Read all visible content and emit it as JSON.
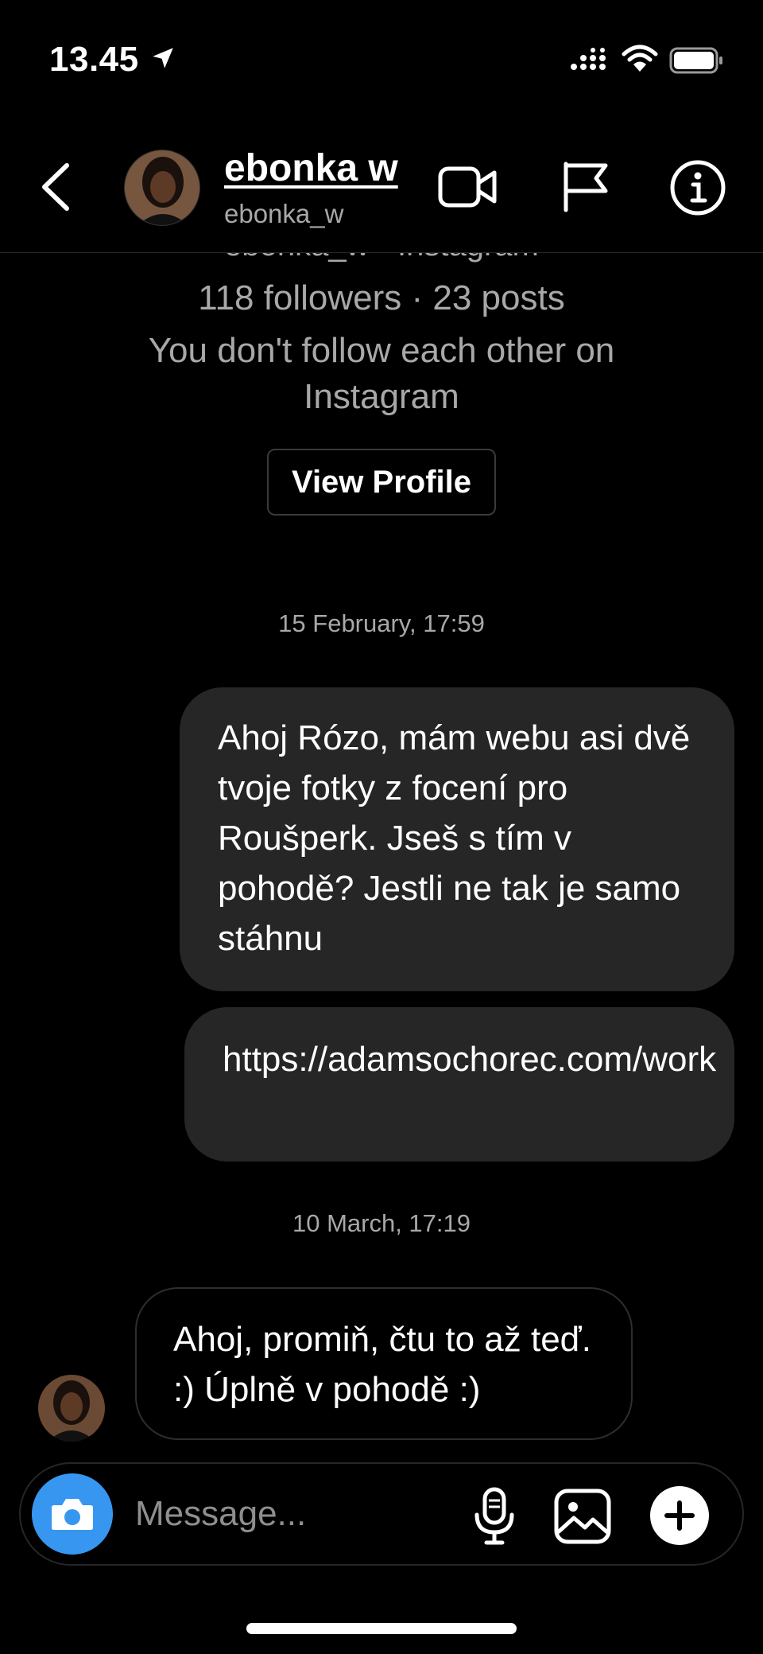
{
  "status_bar": {
    "time": "13.45",
    "icons": [
      "location-arrow-icon",
      "cellular-signal-icon",
      "wifi-icon",
      "battery-icon"
    ]
  },
  "header": {
    "display_name": "ebonka w",
    "username": "ebonka_w",
    "icons": [
      "back-chevron-icon",
      "video-call-icon",
      "flag-icon",
      "info-icon"
    ]
  },
  "profile": {
    "partial_line": "ebonka_w · Instagram",
    "stats": "118 followers · 23 posts",
    "relation": "You don't follow each other on Instagram",
    "view_profile_label": "View Profile"
  },
  "messages": [
    {
      "type": "timestamp",
      "text": "15 February, 17:59"
    },
    {
      "type": "outgoing",
      "text": "Ahoj Rózo, mám webu asi dvě tvoje fotky z focení pro Roušperk. Jseš s tím v pohodě? Jestli ne tak je samo stáhnu"
    },
    {
      "type": "outgoing",
      "text": "https://adamsochorec.com/work"
    },
    {
      "type": "timestamp",
      "text": "10 March, 17:19"
    },
    {
      "type": "incoming",
      "text": "Ahoj, promiň, čtu to až teď. :) Úplně v pohodě :)"
    }
  ],
  "composer": {
    "placeholder": "Message...",
    "icons": [
      "camera-icon",
      "microphone-icon",
      "gallery-icon",
      "plus-icon"
    ]
  },
  "colors": {
    "background": "#000000",
    "bubble_outgoing": "#262626",
    "secondary_text": "#a8a8a8",
    "camera_button": "#3797f0"
  }
}
